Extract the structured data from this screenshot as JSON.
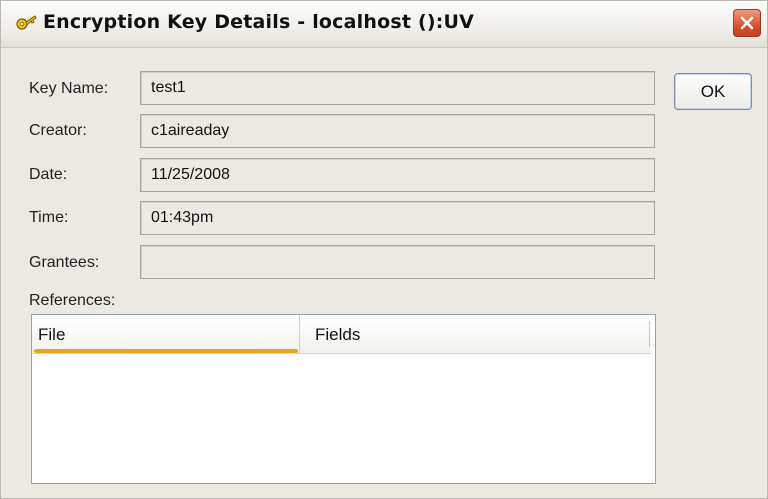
{
  "window": {
    "title": "Encryption Key Details - localhost ():UV",
    "title_icon": "key-icon",
    "close_icon": "close-icon"
  },
  "fields": [
    {
      "label": "Key Name:",
      "value": "test1"
    },
    {
      "label": "Creator:",
      "value": "c1aireaday"
    },
    {
      "label": "Date:",
      "value": "11/25/2008"
    },
    {
      "label": "Time:",
      "value": "01:43pm"
    },
    {
      "label": "Grantees:",
      "value": ""
    }
  ],
  "ok_label": "OK",
  "references": {
    "label": "References:",
    "columns": [
      "File",
      "Fields"
    ],
    "rows": []
  },
  "colors": {
    "dialog_bg": "#ebe9e2",
    "sort_indicator": "#eca21e",
    "close_button": "#d8512f"
  }
}
